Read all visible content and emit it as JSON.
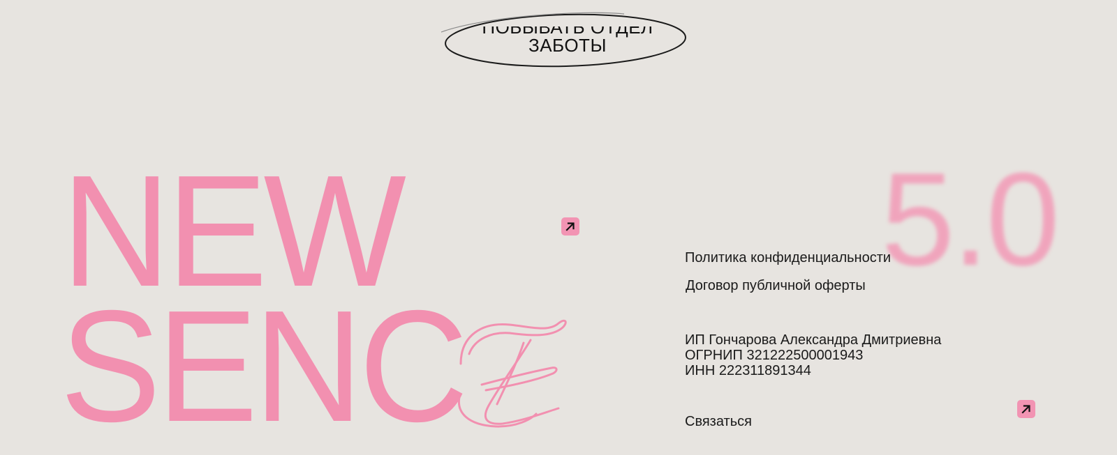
{
  "oval_button": {
    "line1": "ПОБЫВАТЬ ОТДЕЛ",
    "line2": "ЗАБОТЫ"
  },
  "brand": {
    "word1": "NEW",
    "word2": "SENC",
    "script_letter": "E",
    "version": "5.0",
    "color": "#f290b0"
  },
  "links": {
    "privacy": "Политика конфиденциальности",
    "offer": "Договор публичной оферты",
    "contact": "Связаться"
  },
  "legal": {
    "name": "ИП Гончарова Александра Дмитриевна",
    "ogrnip": "ОГРНИП 321222500001943",
    "inn": "ИНН 222311891344"
  },
  "icons": {
    "arrow": "arrow-up-right-icon",
    "accent": "#f294b3"
  }
}
